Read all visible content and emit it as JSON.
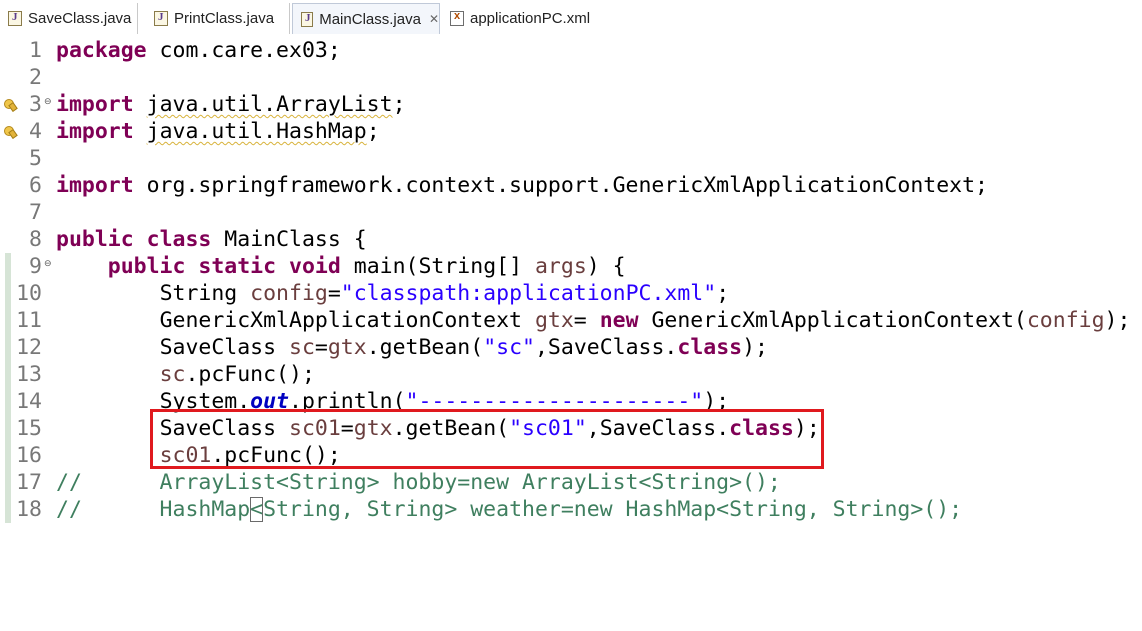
{
  "tabs": [
    {
      "label": "SaveClass.java",
      "icon": "java-file-icon",
      "active": false
    },
    {
      "label": "PrintClass.java",
      "icon": "java-file-icon",
      "active": false
    },
    {
      "label": "MainClass.java",
      "icon": "java-file-icon",
      "active": true,
      "close": "✕"
    },
    {
      "label": "applicationPC.xml",
      "icon": "xml-file-icon",
      "active": false
    }
  ],
  "editor": {
    "lines": [
      {
        "num": "1"
      },
      {
        "num": "2"
      },
      {
        "num": "3"
      },
      {
        "num": "4"
      },
      {
        "num": "5"
      },
      {
        "num": "6"
      },
      {
        "num": "7"
      },
      {
        "num": "8"
      },
      {
        "num": "9"
      },
      {
        "num": "10"
      },
      {
        "num": "11"
      },
      {
        "num": "12"
      },
      {
        "num": "13"
      },
      {
        "num": "14"
      },
      {
        "num": "15"
      },
      {
        "num": "16"
      },
      {
        "num": "17"
      },
      {
        "num": "18"
      }
    ],
    "tokens": {
      "l1_kw": "package",
      "l1_rest": " com.care.ex03;",
      "l3_kw": "import",
      "l3_rest": "java.util.ArrayList",
      "l4_kw": "import",
      "l4_rest": "java.util.HashMap",
      "l6_kw": "import",
      "l6_rest": " org.springframework.context.support.GenericXmlApplicationContext;",
      "l8_kw1": "public",
      "l8_kw2": "class",
      "l8_rest": " MainClass {",
      "l9_kw1": "public",
      "l9_kw2": "static",
      "l9_kw3": "void",
      "l9_a": " main(String[] ",
      "l9_arg": "args",
      "l9_b": ") {",
      "l10_a": "String ",
      "l10_var": "config",
      "l10_b": "=",
      "l10_str": "\"classpath:applicationPC.xml\"",
      "l10_c": ";",
      "l11_a": "GenericXmlApplicationContext ",
      "l11_var": "gtx",
      "l11_b": "= ",
      "l11_kw": "new",
      "l11_c": " GenericXmlApplicationContext(",
      "l11_var2": "config",
      "l11_d": ");",
      "l12_a": "SaveClass ",
      "l12_var": "sc",
      "l12_b": "=",
      "l12_var2": "gtx",
      "l12_c": ".getBean(",
      "l12_str": "\"sc\"",
      "l12_d": ",SaveClass.",
      "l12_kw": "class",
      "l12_e": ");",
      "l13_var": "sc",
      "l13_a": ".pcFunc();",
      "l14_a": "System.",
      "l14_fld": "out",
      "l14_b": ".println(",
      "l14_str": "\"---------------------\"",
      "l14_c": ");",
      "l15_a": "SaveClass ",
      "l15_var": "sc01",
      "l15_b": "=",
      "l15_var2": "gtx",
      "l15_c": ".getBean(",
      "l15_str": "\"sc01\"",
      "l15_d": ",SaveClass.",
      "l15_kw": "class",
      "l15_e": ");",
      "l16_var": "sc01",
      "l16_a": ".pcFunc();",
      "l17_cm": "//      ArrayList<String> hobby=new ArrayList<String>();",
      "l18_cm1": "//      HashMap",
      "l18_br": "<",
      "l18_cm2": "String, String> weather=new HashMap<String, String>();"
    }
  }
}
